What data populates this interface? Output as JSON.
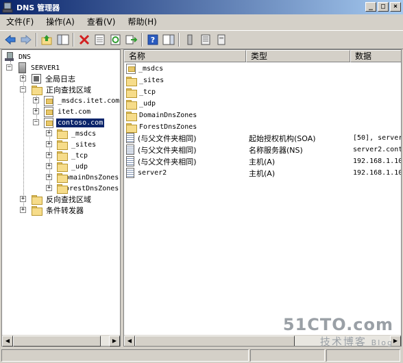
{
  "window": {
    "title": "DNS 管理器",
    "controls": {
      "minimize": "_",
      "maximize": "□",
      "close": "×"
    }
  },
  "menu": [
    {
      "label": "文件(F)"
    },
    {
      "label": "操作(A)"
    },
    {
      "label": "查看(V)"
    },
    {
      "label": "帮助(H)"
    }
  ],
  "toolbar": {
    "icons": [
      "back-icon",
      "forward-icon",
      "up-folder-icon",
      "show-hide-tree-icon",
      "delete-icon",
      "properties-icon",
      "refresh-icon",
      "export-list-icon",
      "help-icon",
      "show-hide-action-pane-icon",
      "server-icon",
      "list-icon",
      "record-icon"
    ]
  },
  "tree": {
    "root": "DNS",
    "server": "SERVER1",
    "global_logs": "全局日志",
    "forward_zones": "正向查找区域",
    "zone_msdcs": "_msdcs.itet.com",
    "zone_itet": "itet.com",
    "zone_contoso": "contoso.com",
    "contoso_children": [
      "_msdcs",
      "_sites",
      "_tcp",
      "_udp",
      "DomainDnsZones",
      "ForestDnsZones"
    ],
    "reverse_zones": "反向查找区域",
    "conditional_forwarders": "条件转发器"
  },
  "list": {
    "columns": [
      "名称",
      "类型",
      "数据"
    ],
    "rows": [
      {
        "name": "_msdcs",
        "type": "",
        "data": "",
        "icon": "zone"
      },
      {
        "name": "_sites",
        "type": "",
        "data": "",
        "icon": "folder"
      },
      {
        "name": "_tcp",
        "type": "",
        "data": "",
        "icon": "folder"
      },
      {
        "name": "_udp",
        "type": "",
        "data": "",
        "icon": "folder"
      },
      {
        "name": "DomainDnsZones",
        "type": "",
        "data": "",
        "icon": "folder"
      },
      {
        "name": "ForestDnsZones",
        "type": "",
        "data": "",
        "icon": "folder"
      },
      {
        "name": "(与父文件夹相同)",
        "type": "起始授权机构(SOA)",
        "data": "[50], server",
        "icon": "record"
      },
      {
        "name": "(与父文件夹相同)",
        "type": "名称服务器(NS)",
        "data": "server2.cont",
        "icon": "record"
      },
      {
        "name": "(与父文件夹相同)",
        "type": "主机(A)",
        "data": "192.168.1.10",
        "icon": "record"
      },
      {
        "name": "server2",
        "type": "主机(A)",
        "data": "192.168.1.10",
        "icon": "record"
      }
    ]
  },
  "watermark": {
    "site": "51CTO.com",
    "tagline": "技术博客",
    "blog": "Blog"
  }
}
